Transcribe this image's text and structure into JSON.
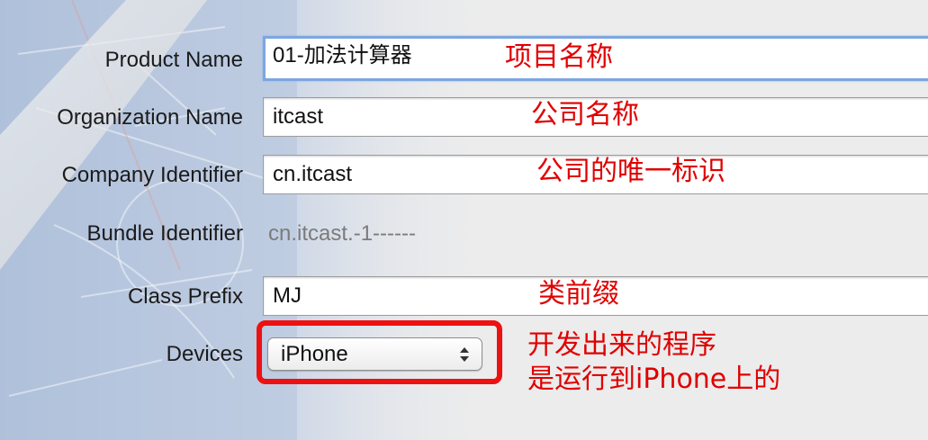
{
  "form": {
    "product_name": {
      "label": "Product Name",
      "value": "01-加法计算器"
    },
    "organization_name": {
      "label": "Organization Name",
      "value": "itcast"
    },
    "company_identifier": {
      "label": "Company Identifier",
      "value": "cn.itcast"
    },
    "bundle_identifier": {
      "label": "Bundle Identifier",
      "value": "cn.itcast.-1------"
    },
    "class_prefix": {
      "label": "Class Prefix",
      "value": "MJ"
    },
    "devices": {
      "label": "Devices",
      "value": "iPhone"
    }
  },
  "annotations": {
    "product_name": "项目名称",
    "organization_name": "公司名称",
    "company_identifier": "公司的唯一标识",
    "class_prefix": "类前缀",
    "devices_line1": "开发出来的程序",
    "devices_line2": "是运行到iPhone上的"
  },
  "colors": {
    "annotation": "#e00000",
    "focus_ring": "#7da6e0",
    "blueprint": "#b7c5dc"
  },
  "icons": {
    "popup_arrows": "up-down-chevron-icon"
  }
}
